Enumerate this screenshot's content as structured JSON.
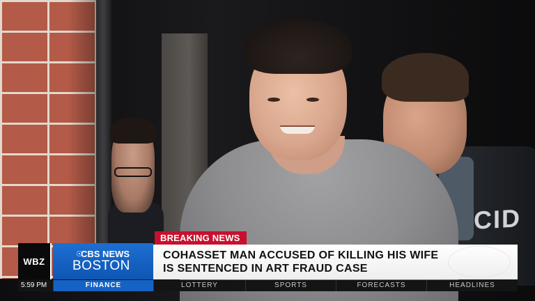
{
  "scene": {
    "jacket_text": "CID"
  },
  "lower_third": {
    "tag": "BREAKING NEWS",
    "station": "WBZ",
    "brand_line1": "CBS NEWS",
    "brand_line2": "BOSTON",
    "brand_eye_icon": "cbs-eye-icon",
    "headline_line1": "COHASSET MAN ACCUSED OF KILLING HIS WIFE",
    "headline_line2": "IS SENTENCED IN ART FRAUD CASE",
    "colors": {
      "tag_red": "#c8102e",
      "brand_blue": "#1463c4"
    }
  },
  "ticker": {
    "time": "5:59 PM",
    "items": [
      "FINANCE",
      "LOTTERY",
      "SPORTS",
      "FORECASTS",
      "HEADLINES"
    ],
    "active": "FINANCE"
  }
}
